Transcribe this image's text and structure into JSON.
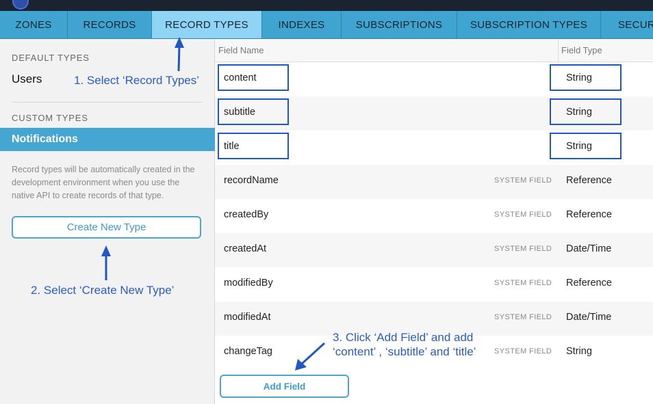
{
  "tabs": [
    "ZONES",
    "RECORDS",
    "RECORD TYPES",
    "INDEXES",
    "SUBSCRIPTIONS",
    "SUBSCRIPTION TYPES",
    "SECURI"
  ],
  "active_tab": "RECORD TYPES",
  "sidebar": {
    "default_header": "DEFAULT TYPES",
    "users": "Users",
    "custom_header": "CUSTOM TYPES",
    "selected": "Notifications",
    "description": "Record types will be automatically created in the development environment when you use the native API to create records of that type.",
    "create_button": "Create New Type"
  },
  "table": {
    "col_name": "Field Name",
    "col_type": "Field Type",
    "rows": [
      {
        "name": "content",
        "badge": "",
        "type": "String"
      },
      {
        "name": "subtitle",
        "badge": "",
        "type": "String"
      },
      {
        "name": "title",
        "badge": "",
        "type": "String"
      },
      {
        "name": "recordName",
        "badge": "SYSTEM FIELD",
        "type": "Reference"
      },
      {
        "name": "createdBy",
        "badge": "SYSTEM FIELD",
        "type": "Reference"
      },
      {
        "name": "createdAt",
        "badge": "SYSTEM FIELD",
        "type": "Date/Time"
      },
      {
        "name": "modifiedBy",
        "badge": "SYSTEM FIELD",
        "type": "Reference"
      },
      {
        "name": "modifiedAt",
        "badge": "SYSTEM FIELD",
        "type": "Date/Time"
      },
      {
        "name": "changeTag",
        "badge": "SYSTEM FIELD",
        "type": "String"
      }
    ],
    "add_button": "Add Field"
  },
  "annotations": {
    "step1": "1. Select ‘Record Types’",
    "step2": "2. Select ‘Create New Type’",
    "step3_line1": "3. Click ‘Add Field’ and add",
    "step3_line2": "‘content’ , ‘subtitle’ and ‘title’"
  },
  "colors": {
    "tab_bar": "#3fa4cf",
    "active_tab": "#8fd3f5",
    "selected_item": "#45a6d1",
    "annotation": "#2a5cc7"
  }
}
